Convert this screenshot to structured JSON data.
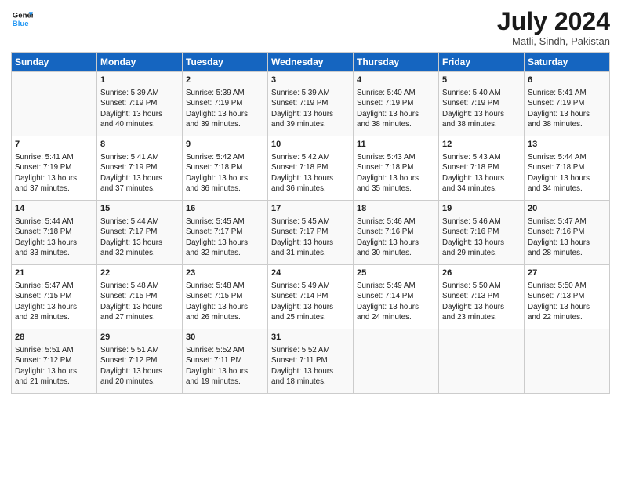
{
  "header": {
    "logo_line1": "General",
    "logo_line2": "Blue",
    "title": "July 2024",
    "subtitle": "Matli, Sindh, Pakistan"
  },
  "days_of_week": [
    "Sunday",
    "Monday",
    "Tuesday",
    "Wednesday",
    "Thursday",
    "Friday",
    "Saturday"
  ],
  "weeks": [
    [
      {
        "day": "",
        "content": ""
      },
      {
        "day": "1",
        "content": "Sunrise: 5:39 AM\nSunset: 7:19 PM\nDaylight: 13 hours\nand 40 minutes."
      },
      {
        "day": "2",
        "content": "Sunrise: 5:39 AM\nSunset: 7:19 PM\nDaylight: 13 hours\nand 39 minutes."
      },
      {
        "day": "3",
        "content": "Sunrise: 5:39 AM\nSunset: 7:19 PM\nDaylight: 13 hours\nand 39 minutes."
      },
      {
        "day": "4",
        "content": "Sunrise: 5:40 AM\nSunset: 7:19 PM\nDaylight: 13 hours\nand 38 minutes."
      },
      {
        "day": "5",
        "content": "Sunrise: 5:40 AM\nSunset: 7:19 PM\nDaylight: 13 hours\nand 38 minutes."
      },
      {
        "day": "6",
        "content": "Sunrise: 5:41 AM\nSunset: 7:19 PM\nDaylight: 13 hours\nand 38 minutes."
      }
    ],
    [
      {
        "day": "7",
        "content": "Sunrise: 5:41 AM\nSunset: 7:19 PM\nDaylight: 13 hours\nand 37 minutes."
      },
      {
        "day": "8",
        "content": "Sunrise: 5:41 AM\nSunset: 7:19 PM\nDaylight: 13 hours\nand 37 minutes."
      },
      {
        "day": "9",
        "content": "Sunrise: 5:42 AM\nSunset: 7:18 PM\nDaylight: 13 hours\nand 36 minutes."
      },
      {
        "day": "10",
        "content": "Sunrise: 5:42 AM\nSunset: 7:18 PM\nDaylight: 13 hours\nand 36 minutes."
      },
      {
        "day": "11",
        "content": "Sunrise: 5:43 AM\nSunset: 7:18 PM\nDaylight: 13 hours\nand 35 minutes."
      },
      {
        "day": "12",
        "content": "Sunrise: 5:43 AM\nSunset: 7:18 PM\nDaylight: 13 hours\nand 34 minutes."
      },
      {
        "day": "13",
        "content": "Sunrise: 5:44 AM\nSunset: 7:18 PM\nDaylight: 13 hours\nand 34 minutes."
      }
    ],
    [
      {
        "day": "14",
        "content": "Sunrise: 5:44 AM\nSunset: 7:18 PM\nDaylight: 13 hours\nand 33 minutes."
      },
      {
        "day": "15",
        "content": "Sunrise: 5:44 AM\nSunset: 7:17 PM\nDaylight: 13 hours\nand 32 minutes."
      },
      {
        "day": "16",
        "content": "Sunrise: 5:45 AM\nSunset: 7:17 PM\nDaylight: 13 hours\nand 32 minutes."
      },
      {
        "day": "17",
        "content": "Sunrise: 5:45 AM\nSunset: 7:17 PM\nDaylight: 13 hours\nand 31 minutes."
      },
      {
        "day": "18",
        "content": "Sunrise: 5:46 AM\nSunset: 7:16 PM\nDaylight: 13 hours\nand 30 minutes."
      },
      {
        "day": "19",
        "content": "Sunrise: 5:46 AM\nSunset: 7:16 PM\nDaylight: 13 hours\nand 29 minutes."
      },
      {
        "day": "20",
        "content": "Sunrise: 5:47 AM\nSunset: 7:16 PM\nDaylight: 13 hours\nand 28 minutes."
      }
    ],
    [
      {
        "day": "21",
        "content": "Sunrise: 5:47 AM\nSunset: 7:15 PM\nDaylight: 13 hours\nand 28 minutes."
      },
      {
        "day": "22",
        "content": "Sunrise: 5:48 AM\nSunset: 7:15 PM\nDaylight: 13 hours\nand 27 minutes."
      },
      {
        "day": "23",
        "content": "Sunrise: 5:48 AM\nSunset: 7:15 PM\nDaylight: 13 hours\nand 26 minutes."
      },
      {
        "day": "24",
        "content": "Sunrise: 5:49 AM\nSunset: 7:14 PM\nDaylight: 13 hours\nand 25 minutes."
      },
      {
        "day": "25",
        "content": "Sunrise: 5:49 AM\nSunset: 7:14 PM\nDaylight: 13 hours\nand 24 minutes."
      },
      {
        "day": "26",
        "content": "Sunrise: 5:50 AM\nSunset: 7:13 PM\nDaylight: 13 hours\nand 23 minutes."
      },
      {
        "day": "27",
        "content": "Sunrise: 5:50 AM\nSunset: 7:13 PM\nDaylight: 13 hours\nand 22 minutes."
      }
    ],
    [
      {
        "day": "28",
        "content": "Sunrise: 5:51 AM\nSunset: 7:12 PM\nDaylight: 13 hours\nand 21 minutes."
      },
      {
        "day": "29",
        "content": "Sunrise: 5:51 AM\nSunset: 7:12 PM\nDaylight: 13 hours\nand 20 minutes."
      },
      {
        "day": "30",
        "content": "Sunrise: 5:52 AM\nSunset: 7:11 PM\nDaylight: 13 hours\nand 19 minutes."
      },
      {
        "day": "31",
        "content": "Sunrise: 5:52 AM\nSunset: 7:11 PM\nDaylight: 13 hours\nand 18 minutes."
      },
      {
        "day": "",
        "content": ""
      },
      {
        "day": "",
        "content": ""
      },
      {
        "day": "",
        "content": ""
      }
    ]
  ]
}
